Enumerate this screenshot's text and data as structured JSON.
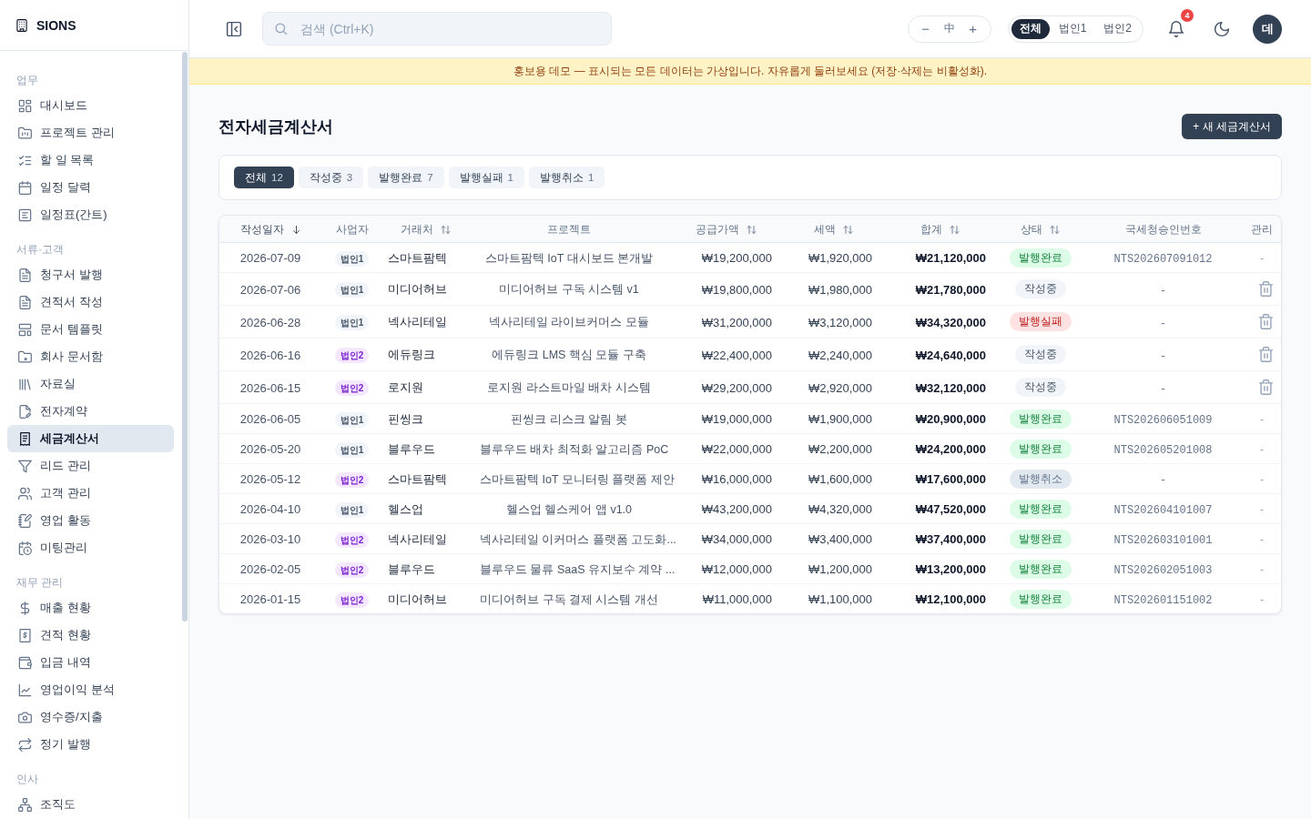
{
  "sidebar": {
    "logo": "SIONS",
    "sections": [
      {
        "title": "업무",
        "items": [
          {
            "label": "대시보드",
            "selected": false
          },
          {
            "label": "프로젝트 관리",
            "selected": false
          },
          {
            "label": "할 일 목록",
            "selected": false
          },
          {
            "label": "일정 달력",
            "selected": false
          },
          {
            "label": "일정표(간트)",
            "selected": false
          }
        ]
      },
      {
        "title": "서류·고객",
        "items": [
          {
            "label": "청구서 발행",
            "selected": false
          },
          {
            "label": "견적서 작성",
            "selected": false
          },
          {
            "label": "문서 템플릿",
            "selected": false
          },
          {
            "label": "회사 문서함",
            "selected": false
          },
          {
            "label": "자료실",
            "selected": false
          },
          {
            "label": "전자계약",
            "selected": false
          },
          {
            "label": "세금계산서",
            "selected": true
          },
          {
            "label": "리드 관리",
            "selected": false
          },
          {
            "label": "고객 관리",
            "selected": false
          },
          {
            "label": "영업 활동",
            "selected": false
          },
          {
            "label": "미팅관리",
            "selected": false
          }
        ]
      },
      {
        "title": "재무 관리",
        "items": [
          {
            "label": "매출 현황",
            "selected": false
          },
          {
            "label": "견적 현황",
            "selected": false
          },
          {
            "label": "입금 내역",
            "selected": false
          },
          {
            "label": "영업이익 분석",
            "selected": false
          },
          {
            "label": "영수증/지출",
            "selected": false
          },
          {
            "label": "정기 발행",
            "selected": false
          }
        ]
      },
      {
        "title": "인사",
        "items": [
          {
            "label": "조직도",
            "selected": false
          }
        ]
      }
    ]
  },
  "topbar": {
    "search": {
      "placeholder": "검색 (Ctrl+K)"
    },
    "zoom": {
      "minus": "−",
      "current": "中",
      "plus": "+"
    },
    "scope_tabs": [
      {
        "label": "전체",
        "selected": true
      },
      {
        "label": "법인1",
        "selected": false
      },
      {
        "label": "법인2",
        "selected": false
      }
    ],
    "notifications": {
      "badge": "4"
    },
    "avatar": "데"
  },
  "banner": "홍보용 데모 — 표시되는 모든 데이터는 가상입니다. 자유롭게 둘러보세요 (저장·삭제는 비활성화).",
  "page": {
    "title": "전자세금계산서",
    "primary_button": "+ 새 세금계산서",
    "filters": [
      {
        "label": "전체",
        "count": "12",
        "selected": true
      },
      {
        "label": "작성중",
        "count": "3",
        "selected": false
      },
      {
        "label": "발행완료",
        "count": "7",
        "selected": false
      },
      {
        "label": "발행실패",
        "count": "1",
        "selected": false
      },
      {
        "label": "발행취소",
        "count": "1",
        "selected": false
      }
    ]
  },
  "table": {
    "columns": [
      {
        "label": "작성일자",
        "sortable": true,
        "sorted": true
      },
      {
        "label": "사업자",
        "sortable": false,
        "sorted": false
      },
      {
        "label": "거래처",
        "sortable": true,
        "sorted": false
      },
      {
        "label": "프로젝트",
        "sortable": false,
        "sorted": false
      },
      {
        "label": "공급가액",
        "sortable": true,
        "sorted": false
      },
      {
        "label": "세액",
        "sortable": true,
        "sorted": false
      },
      {
        "label": "합계",
        "sortable": true,
        "sorted": false
      },
      {
        "label": "상태",
        "sortable": true,
        "sorted": false
      },
      {
        "label": "국세청승인번호",
        "sortable": false,
        "sorted": false
      },
      {
        "label": "관리",
        "sortable": false,
        "sorted": false
      }
    ],
    "rows": [
      {
        "date": "2026-07-09",
        "entity": {
          "label": "법인1",
          "color": "#f1f5f9"
        },
        "client": "스마트팜텍",
        "project": "스마트팜텍 IoT 대시보드 본개발",
        "supply": "₩19,200,000",
        "tax": "₩1,920,000",
        "total": "₩21,120,000",
        "status": {
          "label": "발행완료",
          "color": "#dcfce7"
        },
        "approval_no": "NTS202607091012",
        "action": {
          "kind": "text",
          "text": "-"
        }
      },
      {
        "date": "2026-07-06",
        "entity": {
          "label": "법인1",
          "color": "#f1f5f9"
        },
        "client": "미디어허브",
        "project": "미디어허브 구독 시스템 v1",
        "supply": "₩19,800,000",
        "tax": "₩1,980,000",
        "total": "₩21,780,000",
        "status": {
          "label": "작성중",
          "color": "#f1f5f9"
        },
        "approval_no": "-",
        "action": {
          "kind": "button"
        }
      },
      {
        "date": "2026-06-28",
        "entity": {
          "label": "법인1",
          "color": "#f1f5f9"
        },
        "client": "넥사리테일",
        "project": "넥사리테일 라이브커머스 모듈",
        "supply": "₩31,200,000",
        "tax": "₩3,120,000",
        "total": "₩34,320,000",
        "status": {
          "label": "발행실패",
          "color": "#fee2e2"
        },
        "approval_no": "-",
        "action": {
          "kind": "button"
        }
      },
      {
        "date": "2026-06-16",
        "entity": {
          "label": "법인2",
          "color": "#f3e8ff"
        },
        "client": "에듀링크",
        "project": "에듀링크 LMS 핵심 모듈 구축",
        "supply": "₩22,400,000",
        "tax": "₩2,240,000",
        "total": "₩24,640,000",
        "status": {
          "label": "작성중",
          "color": "#f1f5f9"
        },
        "approval_no": "-",
        "action": {
          "kind": "button"
        }
      },
      {
        "date": "2026-06-15",
        "entity": {
          "label": "법인2",
          "color": "#f3e8ff"
        },
        "client": "로지원",
        "project": "로지원 라스트마일 배차 시스템",
        "supply": "₩29,200,000",
        "tax": "₩2,920,000",
        "total": "₩32,120,000",
        "status": {
          "label": "작성중",
          "color": "#f1f5f9"
        },
        "approval_no": "-",
        "action": {
          "kind": "button"
        }
      },
      {
        "date": "2026-06-05",
        "entity": {
          "label": "법인1",
          "color": "#f1f5f9"
        },
        "client": "핀씽크",
        "project": "핀씽크 리스크 알림 봇",
        "supply": "₩19,000,000",
        "tax": "₩1,900,000",
        "total": "₩20,900,000",
        "status": {
          "label": "발행완료",
          "color": "#dcfce7"
        },
        "approval_no": "NTS202606051009",
        "action": {
          "kind": "text",
          "text": "-"
        }
      },
      {
        "date": "2026-05-20",
        "entity": {
          "label": "법인1",
          "color": "#f1f5f9"
        },
        "client": "블루우드",
        "project": "블루우드 배차 최적화 알고리즘 PoC",
        "supply": "₩22,000,000",
        "tax": "₩2,200,000",
        "total": "₩24,200,000",
        "status": {
          "label": "발행완료",
          "color": "#dcfce7"
        },
        "approval_no": "NTS202605201008",
        "action": {
          "kind": "text",
          "text": "-"
        }
      },
      {
        "date": "2026-05-12",
        "entity": {
          "label": "법인2",
          "color": "#f3e8ff"
        },
        "client": "스마트팜텍",
        "project": "스마트팜텍 IoT 모니터링 플랫폼 제안",
        "supply": "₩16,000,000",
        "tax": "₩1,600,000",
        "total": "₩17,600,000",
        "status": {
          "label": "발행취소",
          "color": "#e2e8f0"
        },
        "approval_no": "-",
        "action": {
          "kind": "text",
          "text": "-"
        }
      },
      {
        "date": "2026-04-10",
        "entity": {
          "label": "법인1",
          "color": "#f1f5f9"
        },
        "client": "헬스업",
        "project": "헬스업 헬스케어 앱 v1.0",
        "supply": "₩43,200,000",
        "tax": "₩4,320,000",
        "total": "₩47,520,000",
        "status": {
          "label": "발행완료",
          "color": "#dcfce7"
        },
        "approval_no": "NTS202604101007",
        "action": {
          "kind": "text",
          "text": "-"
        }
      },
      {
        "date": "2026-03-10",
        "entity": {
          "label": "법인2",
          "color": "#f3e8ff"
        },
        "client": "넥사리테일",
        "project": "넥사리테일 이커머스 플랫폼 고도화...",
        "supply": "₩34,000,000",
        "tax": "₩3,400,000",
        "total": "₩37,400,000",
        "status": {
          "label": "발행완료",
          "color": "#dcfce7"
        },
        "approval_no": "NTS202603101001",
        "action": {
          "kind": "text",
          "text": "-"
        }
      },
      {
        "date": "2026-02-05",
        "entity": {
          "label": "법인2",
          "color": "#f3e8ff"
        },
        "client": "블루우드",
        "project": "블루우드 물류 SaaS 유지보수 계약 ...",
        "supply": "₩12,000,000",
        "tax": "₩1,200,000",
        "total": "₩13,200,000",
        "status": {
          "label": "발행완료",
          "color": "#dcfce7"
        },
        "approval_no": "NTS202602051003",
        "action": {
          "kind": "text",
          "text": "-"
        }
      },
      {
        "date": "2026-01-15",
        "entity": {
          "label": "법인2",
          "color": "#f3e8ff"
        },
        "client": "미디어허브",
        "project": "미디어허브 구독 결제 시스템 개선",
        "supply": "₩11,000,000",
        "tax": "₩1,100,000",
        "total": "₩12,100,000",
        "status": {
          "label": "발행완료",
          "color": "#dcfce7"
        },
        "approval_no": "NTS202601151002",
        "action": {
          "kind": "text",
          "text": "-"
        }
      }
    ]
  }
}
